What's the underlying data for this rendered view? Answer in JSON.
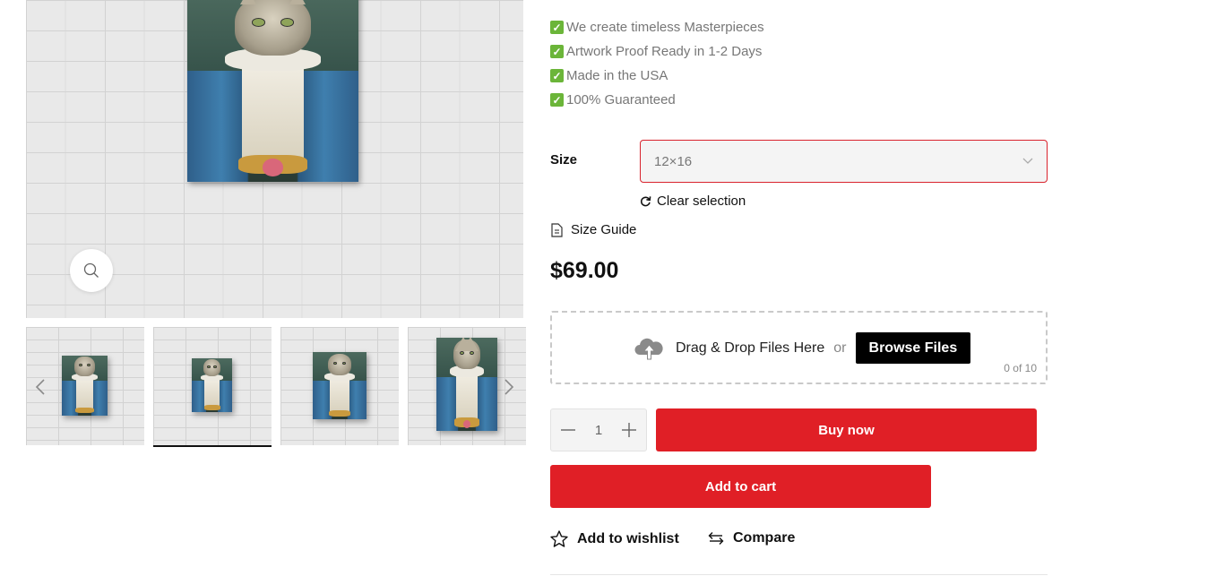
{
  "features": [
    {
      "icon": "check-icon",
      "text": "We create timeless Masterpieces"
    },
    {
      "icon": "check-icon",
      "text": "Artwork Proof Ready in 1-2 Days"
    },
    {
      "icon": "check-icon",
      "text": "Made in the USA"
    },
    {
      "icon": "check-icon",
      "text": "100% Guaranteed"
    }
  ],
  "size": {
    "label": "Size",
    "selected": "12×16",
    "clear_label": "Clear selection",
    "guide_label": "Size Guide"
  },
  "price": "$69.00",
  "upload": {
    "text": "Drag & Drop Files Here",
    "or": "or",
    "browse_label": "Browse Files",
    "count": "0 of 10",
    "icon": "cloud-upload-icon"
  },
  "quantity": {
    "value": "1",
    "decrement_icon": "minus-icon",
    "increment_icon": "plus-icon"
  },
  "actions": {
    "buy_now": "Buy now",
    "add_to_cart": "Add to cart",
    "wishlist": "Add to wishlist",
    "compare": "Compare"
  },
  "gallery": {
    "thumbnail_count": 4,
    "active_thumbnail": 2
  },
  "colors": {
    "accent_red": "#e01f26",
    "check_green": "#6bb539",
    "select_border": "#d9232d"
  }
}
